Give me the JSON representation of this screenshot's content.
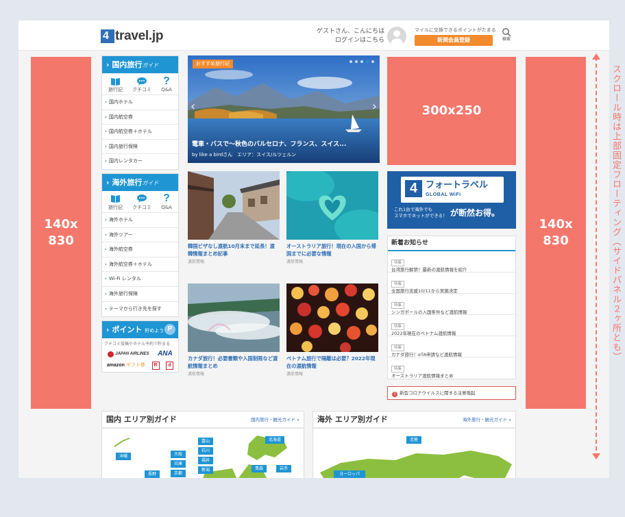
{
  "header": {
    "logo_text": "travel.jp",
    "logo_mark": "4",
    "greeting_line1": "ゲストさん、こんにちは",
    "greeting_line2": "ログインはこちら",
    "promo_text": "マイルに交換できるポイントがたまる",
    "signup_button": "新規会員登録",
    "search_label": "検索"
  },
  "ads": {
    "left": "140x\n830",
    "right": "140x\n830",
    "rectangle": "300x250"
  },
  "domestic_guide": {
    "title": "国内旅行",
    "title_en": "ガイド",
    "icons": [
      {
        "label": "旅行記",
        "icon": "book-icon"
      },
      {
        "label": "クチコミ",
        "icon": "speech-bubble-icon"
      },
      {
        "label": "Q&A",
        "icon": "question-icon"
      }
    ],
    "links": [
      "国内ホテル",
      "国内航空券",
      "国内航空券＋ホテル",
      "国内旅行保険",
      "国内レンタカー"
    ]
  },
  "overseas_guide": {
    "title": "海外旅行",
    "title_en": "ガイド",
    "icons": [
      {
        "label": "旅行記",
        "icon": "book-icon"
      },
      {
        "label": "クチコミ",
        "icon": "speech-bubble-icon"
      },
      {
        "label": "Q&A",
        "icon": "question-icon"
      }
    ],
    "links": [
      "海外ホテル",
      "海外ツアー",
      "海外航空券",
      "海外航空券＋ホテル",
      "Wi-Fi レンタル",
      "海外旅行保険",
      "テーマから行き先を探す"
    ]
  },
  "points": {
    "title": "ポイント",
    "title_small": "貯めよう",
    "icon": "P",
    "note": "クチコミ投稿やホテル予約で貯まる",
    "partners": [
      "JAPAN AIRLINES",
      "ANA",
      "amazon",
      "ギフト券",
      "R",
      "d"
    ]
  },
  "hero": {
    "tag": "おすすめ旅行記",
    "title": "電車・バスで～秋色のバルセロナ、フランス、スイス...",
    "byline": "by like a birdさん　エリア：スイス/ルツェルン"
  },
  "articles": [
    {
      "title": "韓国ビザなし渡航10月末まで延長！渡韓情報まとめ記事",
      "category": "渡航情報"
    },
    {
      "title": "オーストラリア旅行！現在の入国から帰国までに必要な情報",
      "category": "渡航情報"
    },
    {
      "title": "カナダ旅行！必要書類や入国制限など渡航情報まとめ",
      "category": "渡航情報"
    },
    {
      "title": "ベトナム旅行で隔離は必要？2022年現在の渡航情報",
      "category": "渡航情報"
    }
  ],
  "wifi_banner": {
    "mark": "4",
    "brand": "フォートラベル",
    "sub": "GLOBAL WiFi",
    "note": "これ1台で海外でも\nスマホでネットができる！",
    "cta": "が断然お得。"
  },
  "news": {
    "title": "新着お知らせ",
    "items": [
      {
        "tag": "特集",
        "text": "台湾旅行解禁！最新の渡航情報を紹介"
      },
      {
        "tag": "特集",
        "text": "全国旅行支援10/11から実施決定"
      },
      {
        "tag": "特集",
        "text": "シンガポールの入国条件など渡航情報"
      },
      {
        "tag": "特集",
        "text": "2022年現在のベトナム渡航情報"
      },
      {
        "tag": "特集",
        "text": "カナダ旅行！eTA申請など渡航情報"
      },
      {
        "tag": "特集",
        "text": "オーストラリア渡航情報まとめ"
      }
    ]
  },
  "alert": {
    "icon": "!",
    "text": "新型コロナウイルスに関する注意喚起"
  },
  "area_domestic": {
    "title": "国内 エリア別ガイド",
    "link": "国内旅行・観光ガイド »",
    "prefs": [
      "沖縄",
      "大阪",
      "兵庫",
      "京都",
      "富山",
      "石川",
      "福井",
      "新潟",
      "北海道",
      "青森",
      "岩手",
      "長野"
    ]
  },
  "area_overseas": {
    "title": "海外 エリア別ガイド",
    "link": "海外旅行・観光ガイド »",
    "regions": [
      "北極",
      "ヨーロッパ"
    ]
  },
  "annotation": {
    "text": "スクロール時は上部固定フローティング（サイドパネル２ヶ所とも）"
  },
  "colors": {
    "ad": "#f4776b",
    "brand_blue": "#1f95d3",
    "orange": "#f28a2e",
    "link_blue": "#2e6db4"
  }
}
